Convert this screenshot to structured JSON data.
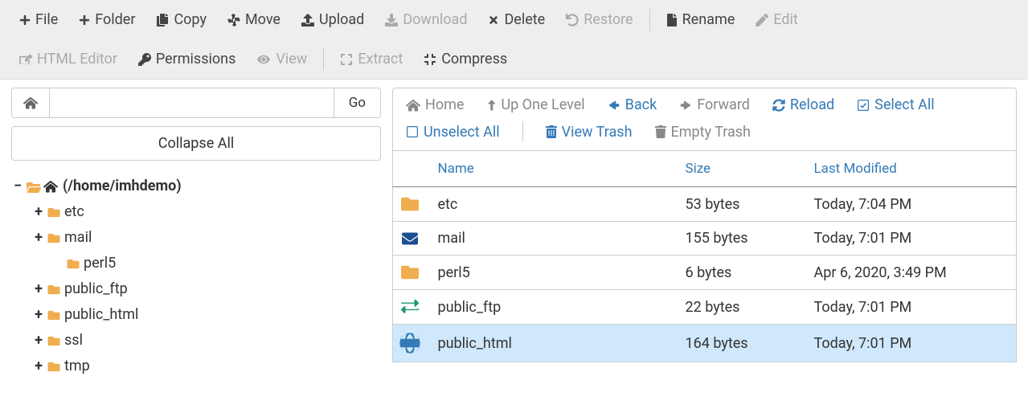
{
  "toolbar": {
    "row1": [
      {
        "id": "file",
        "label": "File",
        "icon": "plus",
        "enabled": true
      },
      {
        "id": "folder",
        "label": "Folder",
        "icon": "plus",
        "enabled": true
      },
      {
        "id": "copy",
        "label": "Copy",
        "icon": "copy",
        "enabled": true
      },
      {
        "id": "move",
        "label": "Move",
        "icon": "move",
        "enabled": true
      },
      {
        "id": "upload",
        "label": "Upload",
        "icon": "upload",
        "enabled": true
      },
      {
        "id": "download",
        "label": "Download",
        "icon": "download",
        "enabled": false
      },
      {
        "id": "delete",
        "label": "Delete",
        "icon": "x",
        "enabled": true
      },
      {
        "id": "restore",
        "label": "Restore",
        "icon": "undo",
        "enabled": false
      },
      {
        "sep": true
      },
      {
        "id": "rename",
        "label": "Rename",
        "icon": "file",
        "enabled": true
      },
      {
        "id": "edit",
        "label": "Edit",
        "icon": "pencil",
        "enabled": false
      }
    ],
    "row2": [
      {
        "id": "htmleditor",
        "label": "HTML Editor",
        "icon": "edit-square",
        "enabled": false
      },
      {
        "id": "permissions",
        "label": "Permissions",
        "icon": "key",
        "enabled": true
      },
      {
        "id": "view",
        "label": "View",
        "icon": "eye",
        "enabled": false
      },
      {
        "sep": true
      },
      {
        "id": "extract",
        "label": "Extract",
        "icon": "expand",
        "enabled": false
      },
      {
        "id": "compress",
        "label": "Compress",
        "icon": "compress",
        "enabled": true
      }
    ]
  },
  "path_input": "",
  "go_label": "Go",
  "collapse_label": "Collapse All",
  "tree": {
    "root": {
      "label": "(/home/imhdemo)",
      "expanded": true
    },
    "children": [
      {
        "label": "etc",
        "toggle": "+"
      },
      {
        "label": "mail",
        "toggle": "+"
      },
      {
        "label": "perl5",
        "toggle": ""
      },
      {
        "label": "public_ftp",
        "toggle": "+"
      },
      {
        "label": "public_html",
        "toggle": "+"
      },
      {
        "label": "ssl",
        "toggle": "+"
      },
      {
        "label": "tmp",
        "toggle": "+"
      }
    ]
  },
  "navbar": [
    {
      "id": "home",
      "label": "Home",
      "icon": "home",
      "style": "dim"
    },
    {
      "id": "up",
      "label": "Up One Level",
      "icon": "level-up",
      "style": "dim"
    },
    {
      "id": "back",
      "label": "Back",
      "icon": "arrow-left",
      "style": "active"
    },
    {
      "id": "forward",
      "label": "Forward",
      "icon": "arrow-right",
      "style": "dim"
    },
    {
      "id": "reload",
      "label": "Reload",
      "icon": "refresh",
      "style": "active"
    },
    {
      "id": "selectall",
      "label": "Select All",
      "icon": "check-square",
      "style": "active"
    },
    {
      "id": "unselectall",
      "label": "Unselect All",
      "icon": "square",
      "style": "active"
    },
    {
      "sep": true
    },
    {
      "id": "viewtrash",
      "label": "View Trash",
      "icon": "trash-full",
      "style": "active"
    },
    {
      "id": "emptytrash",
      "label": "Empty Trash",
      "icon": "trash",
      "style": "dim"
    }
  ],
  "columns": {
    "name": "Name",
    "size": "Size",
    "modified": "Last Modified"
  },
  "files": [
    {
      "name": "etc",
      "size": "53 bytes",
      "modified": "Today, 7:04 PM",
      "icon": "folder",
      "selected": false
    },
    {
      "name": "mail",
      "size": "155 bytes",
      "modified": "Today, 7:01 PM",
      "icon": "envelope",
      "selected": false
    },
    {
      "name": "perl5",
      "size": "6 bytes",
      "modified": "Apr 6, 2020, 3:49 PM",
      "icon": "folder",
      "selected": false
    },
    {
      "name": "public_ftp",
      "size": "22 bytes",
      "modified": "Today, 7:01 PM",
      "icon": "exchange",
      "selected": false
    },
    {
      "name": "public_html",
      "size": "164 bytes",
      "modified": "Today, 7:01 PM",
      "icon": "globe",
      "selected": true
    }
  ]
}
